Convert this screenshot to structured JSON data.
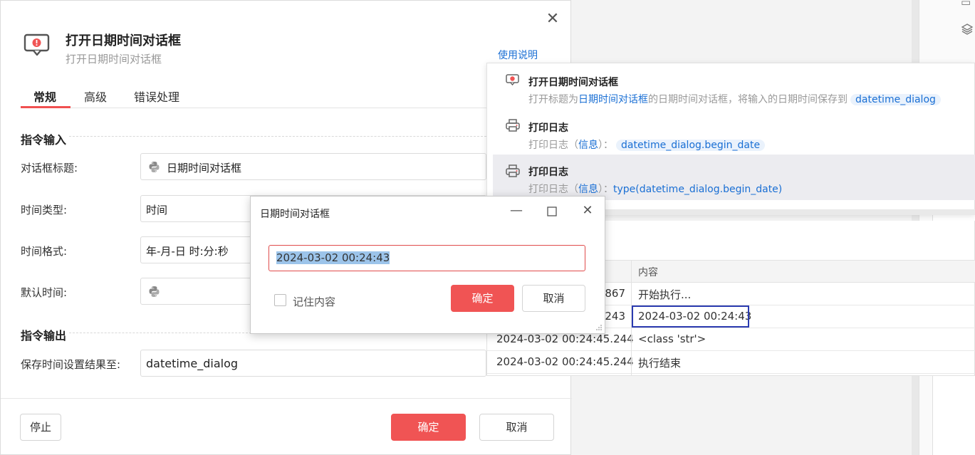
{
  "dialog": {
    "title": "打开日期时间对话框",
    "subtitle": "打开日期时间对话框",
    "help_link": "使用说明",
    "tabs": [
      "常规",
      "高级",
      "错误处理"
    ],
    "section_input": "指令输入",
    "section_output": "指令输出",
    "fields": {
      "dialog_title_label": "对话框标题:",
      "dialog_title_value": "日期时间对话框",
      "time_type_label": "时间类型:",
      "time_type_value": "时间",
      "time_format_label": "时间格式:",
      "time_format_value": "年-月-日 时:分:秒",
      "default_time_label": "默认时间:",
      "default_time_value": "",
      "save_to_label": "保存时间设置结果至:",
      "save_to_value": "datetime_dialog"
    },
    "stop_button": "停止",
    "ok_button": "确定",
    "cancel_button": "取消"
  },
  "flow": {
    "items": [
      {
        "name": "打开日期时间对话框",
        "desc_prefix": "打开标题为",
        "desc_link": "日期时间对话框",
        "desc_suffix": "的日期时间对话框，将输入的日期时间保存到",
        "tag": "datetime_dialog"
      },
      {
        "name": "打印日志",
        "desc_prefix": "打印日志（",
        "desc_link": "信息",
        "desc_suffix": "）：",
        "tag": "datetime_dialog.begin_date"
      },
      {
        "name": "打印日志",
        "desc_prefix": "打印日志（",
        "desc_link": "信息",
        "desc_suffix": "）：",
        "expr": "type(datetime_dialog.begin_date)"
      }
    ]
  },
  "log": {
    "header_content": "内容",
    "rows": [
      {
        "time": "867",
        "content": "开始执行..."
      },
      {
        "time": "243",
        "content": "2024-03-02 00:24:43"
      },
      {
        "time": "2024-03-02 00:24:45.244",
        "content": "<class 'str'>"
      },
      {
        "time": "2024-03-02 00:24:45.244",
        "content": "执行结束"
      }
    ]
  },
  "popup": {
    "title": "日期时间对话框",
    "value": "2024-03-02 00:24:43",
    "remember_label": "记住内容",
    "ok_button": "确定",
    "cancel_button": "取消"
  },
  "colors": {
    "primary": "#f05454",
    "link": "#1a6fd4",
    "focus": "#2b3bb0"
  }
}
